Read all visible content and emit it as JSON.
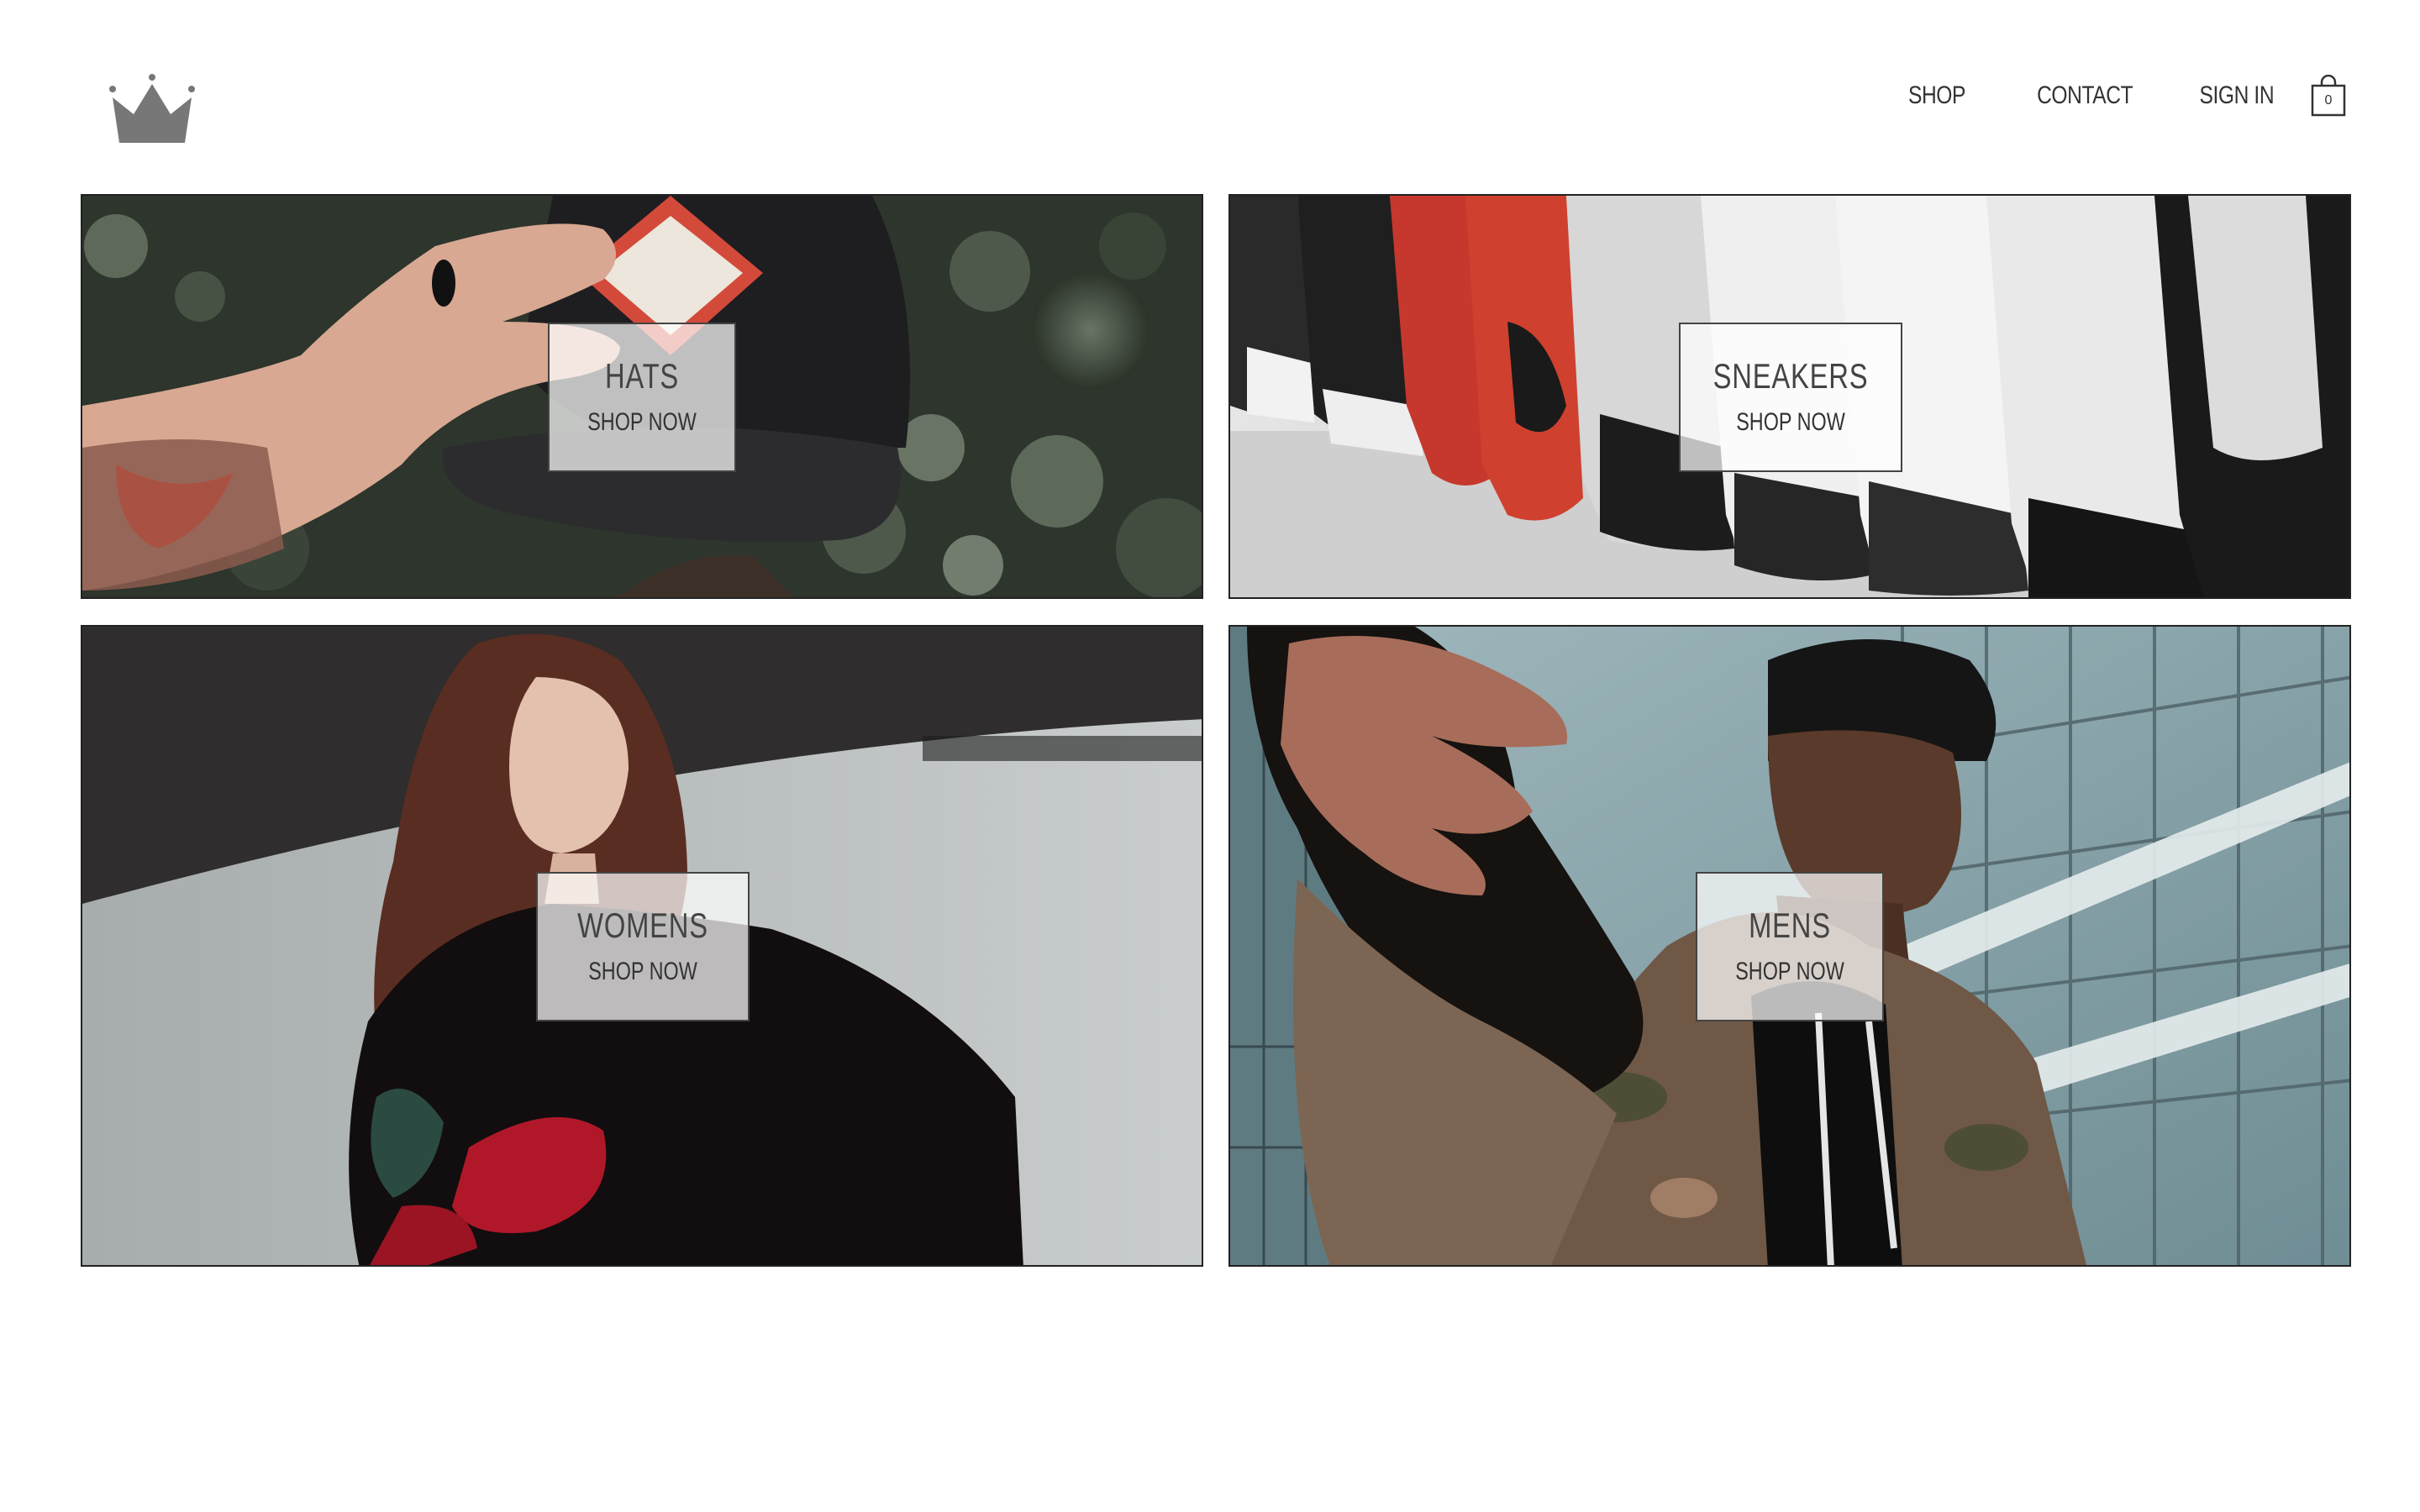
{
  "header": {
    "logo_icon": "crown-icon",
    "nav": [
      {
        "label": "SHOP"
      },
      {
        "label": "CONTACT"
      },
      {
        "label": "SIGN IN"
      }
    ],
    "cart": {
      "icon": "shopping-bag-icon",
      "count": "0"
    }
  },
  "categories": [
    {
      "title": "HATS",
      "cta": "SHOP NOW"
    },
    {
      "title": "SNEAKERS",
      "cta": "SHOP NOW"
    },
    {
      "title": "WOMENS",
      "cta": "SHOP NOW"
    },
    {
      "title": "MENS",
      "cta": "SHOP NOW"
    }
  ],
  "colors": {
    "text": "#333333",
    "border": "#222222",
    "logo": "#777777",
    "label_bg": "rgba(255,255,255,0.72)"
  }
}
